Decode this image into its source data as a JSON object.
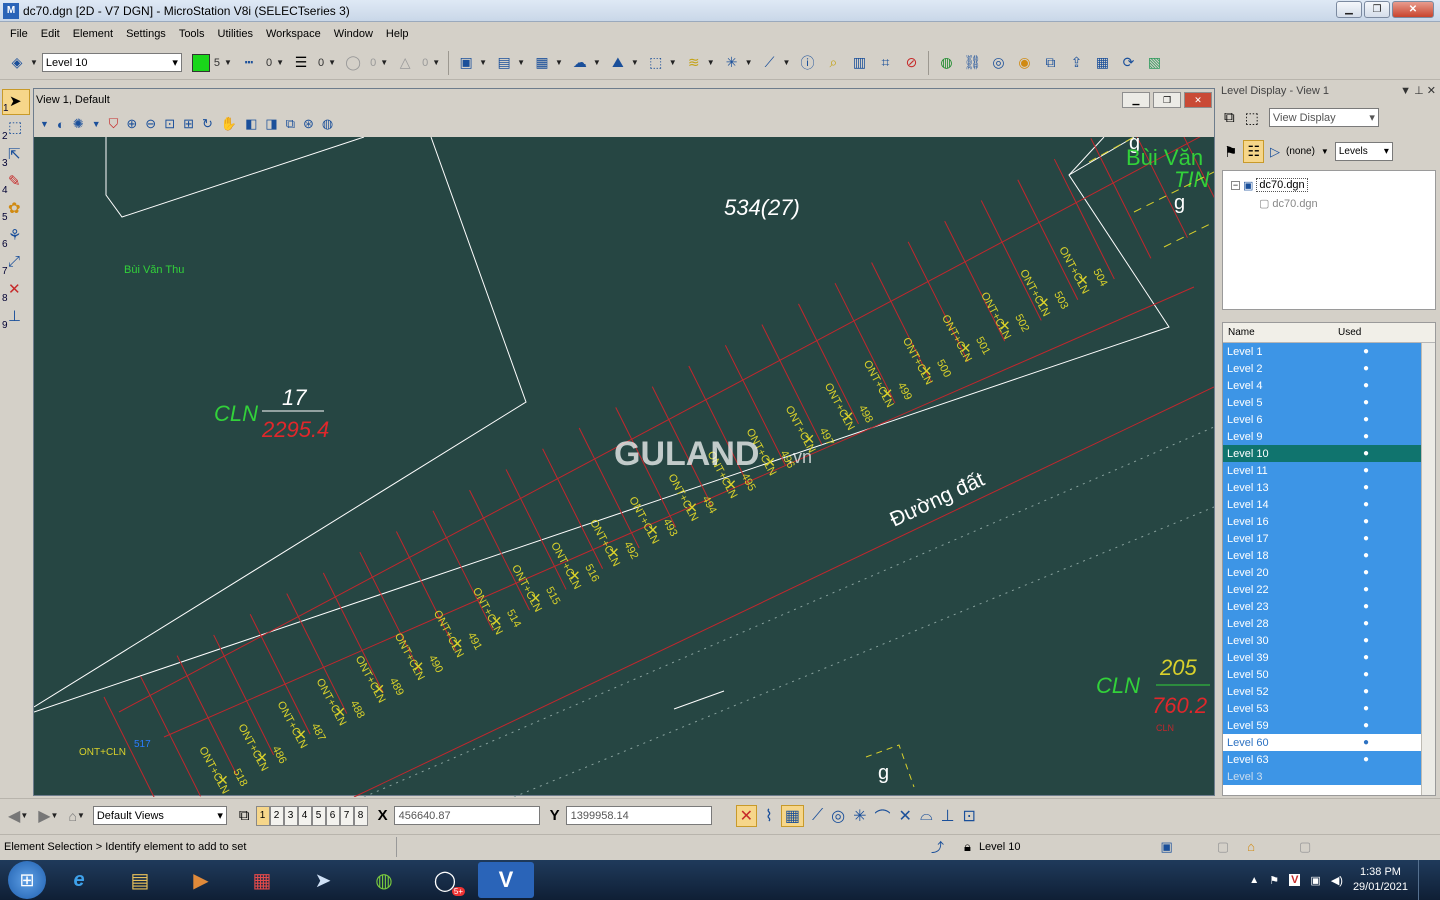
{
  "window": {
    "title": "dc70.dgn [2D - V7 DGN] - MicroStation V8i (SELECTseries 3)",
    "app_icon": "M"
  },
  "menu": [
    "File",
    "Edit",
    "Element",
    "Settings",
    "Tools",
    "Utilities",
    "Workspace",
    "Window",
    "Help"
  ],
  "toolbar": {
    "active_level": "Level 10",
    "color_value": "5",
    "style_value": "0",
    "weight_value": "0",
    "transparency_value": "0",
    "priority_value": "0",
    "color_swatch": "#19d61a"
  },
  "left_tool_numbers": [
    "1",
    "2",
    "3",
    "4",
    "5",
    "6",
    "7",
    "8",
    "9"
  ],
  "view": {
    "title": "View 1, Default"
  },
  "drawing": {
    "parcel_main": "534(27)",
    "owner_label": "Bùi Văn Thu",
    "cln_left": "CLN",
    "num_17": "17",
    "area_left": "2295.4",
    "road_label": "Đường đất",
    "watermark": "GULAND",
    "watermark_suffix": ".vn",
    "top_right_g": "g",
    "top_right_name_1": "Bùi Văn",
    "top_right_name_2": "TIN",
    "cln_right": "CLN",
    "num_205": "205",
    "area_right": "760.2",
    "cln_small": "CLN",
    "bottom_g": "g",
    "bottom_left_small": "ONT+CLN",
    "bottom_left_small_num": "517",
    "lot_prefix": "ONT+CLN",
    "lots_upper": [
      "504",
      "503",
      "502",
      "501",
      "500",
      "499",
      "498",
      "497",
      "496",
      "495",
      "494",
      "493",
      "492",
      "516",
      "515",
      "514",
      "491",
      "490",
      "489",
      "488",
      "487",
      "486",
      "518"
    ]
  },
  "level_panel": {
    "title": "Level Display - View 1",
    "view_display": "View Display",
    "filter_none": "(none)",
    "levels_dropdown": "Levels",
    "tree_root": "dc70.dgn",
    "tree_child": "dc70.dgn",
    "col_name": "Name",
    "col_used": "Used",
    "levels": [
      "Level 1",
      "Level 2",
      "Level 4",
      "Level 5",
      "Level 6",
      "Level 9",
      "Level 10",
      "Level 11",
      "Level 13",
      "Level 14",
      "Level 16",
      "Level 17",
      "Level 18",
      "Level 20",
      "Level 22",
      "Level 23",
      "Level 28",
      "Level 30",
      "Level 39",
      "Level 50",
      "Level 52",
      "Level 53",
      "Level 59",
      "Level 60",
      "Level 63",
      "Level 3"
    ],
    "active_level": "Level 10",
    "selected_level": "Level 60"
  },
  "bottom": {
    "views_combo": "Default Views",
    "view_numbers": [
      "1",
      "2",
      "3",
      "4",
      "5",
      "6",
      "7",
      "8"
    ],
    "x_label": "X",
    "x_value": "456640.87",
    "y_label": "Y",
    "y_value": "1399958.14"
  },
  "status": {
    "prompt": "Element Selection > Identify element to add to set",
    "level": "Level 10"
  },
  "taskbar": {
    "time": "1:38 PM",
    "date": "29/01/2021",
    "zalo_badge": "5+"
  },
  "colors": {
    "canvas": "#264643",
    "lot_line": "#c1272d",
    "lot_text": "#d9d12b",
    "white_line": "#ffffff",
    "green_text": "#32d13a",
    "red_text": "#e0272b",
    "level_highlight": "#3d95e6"
  }
}
